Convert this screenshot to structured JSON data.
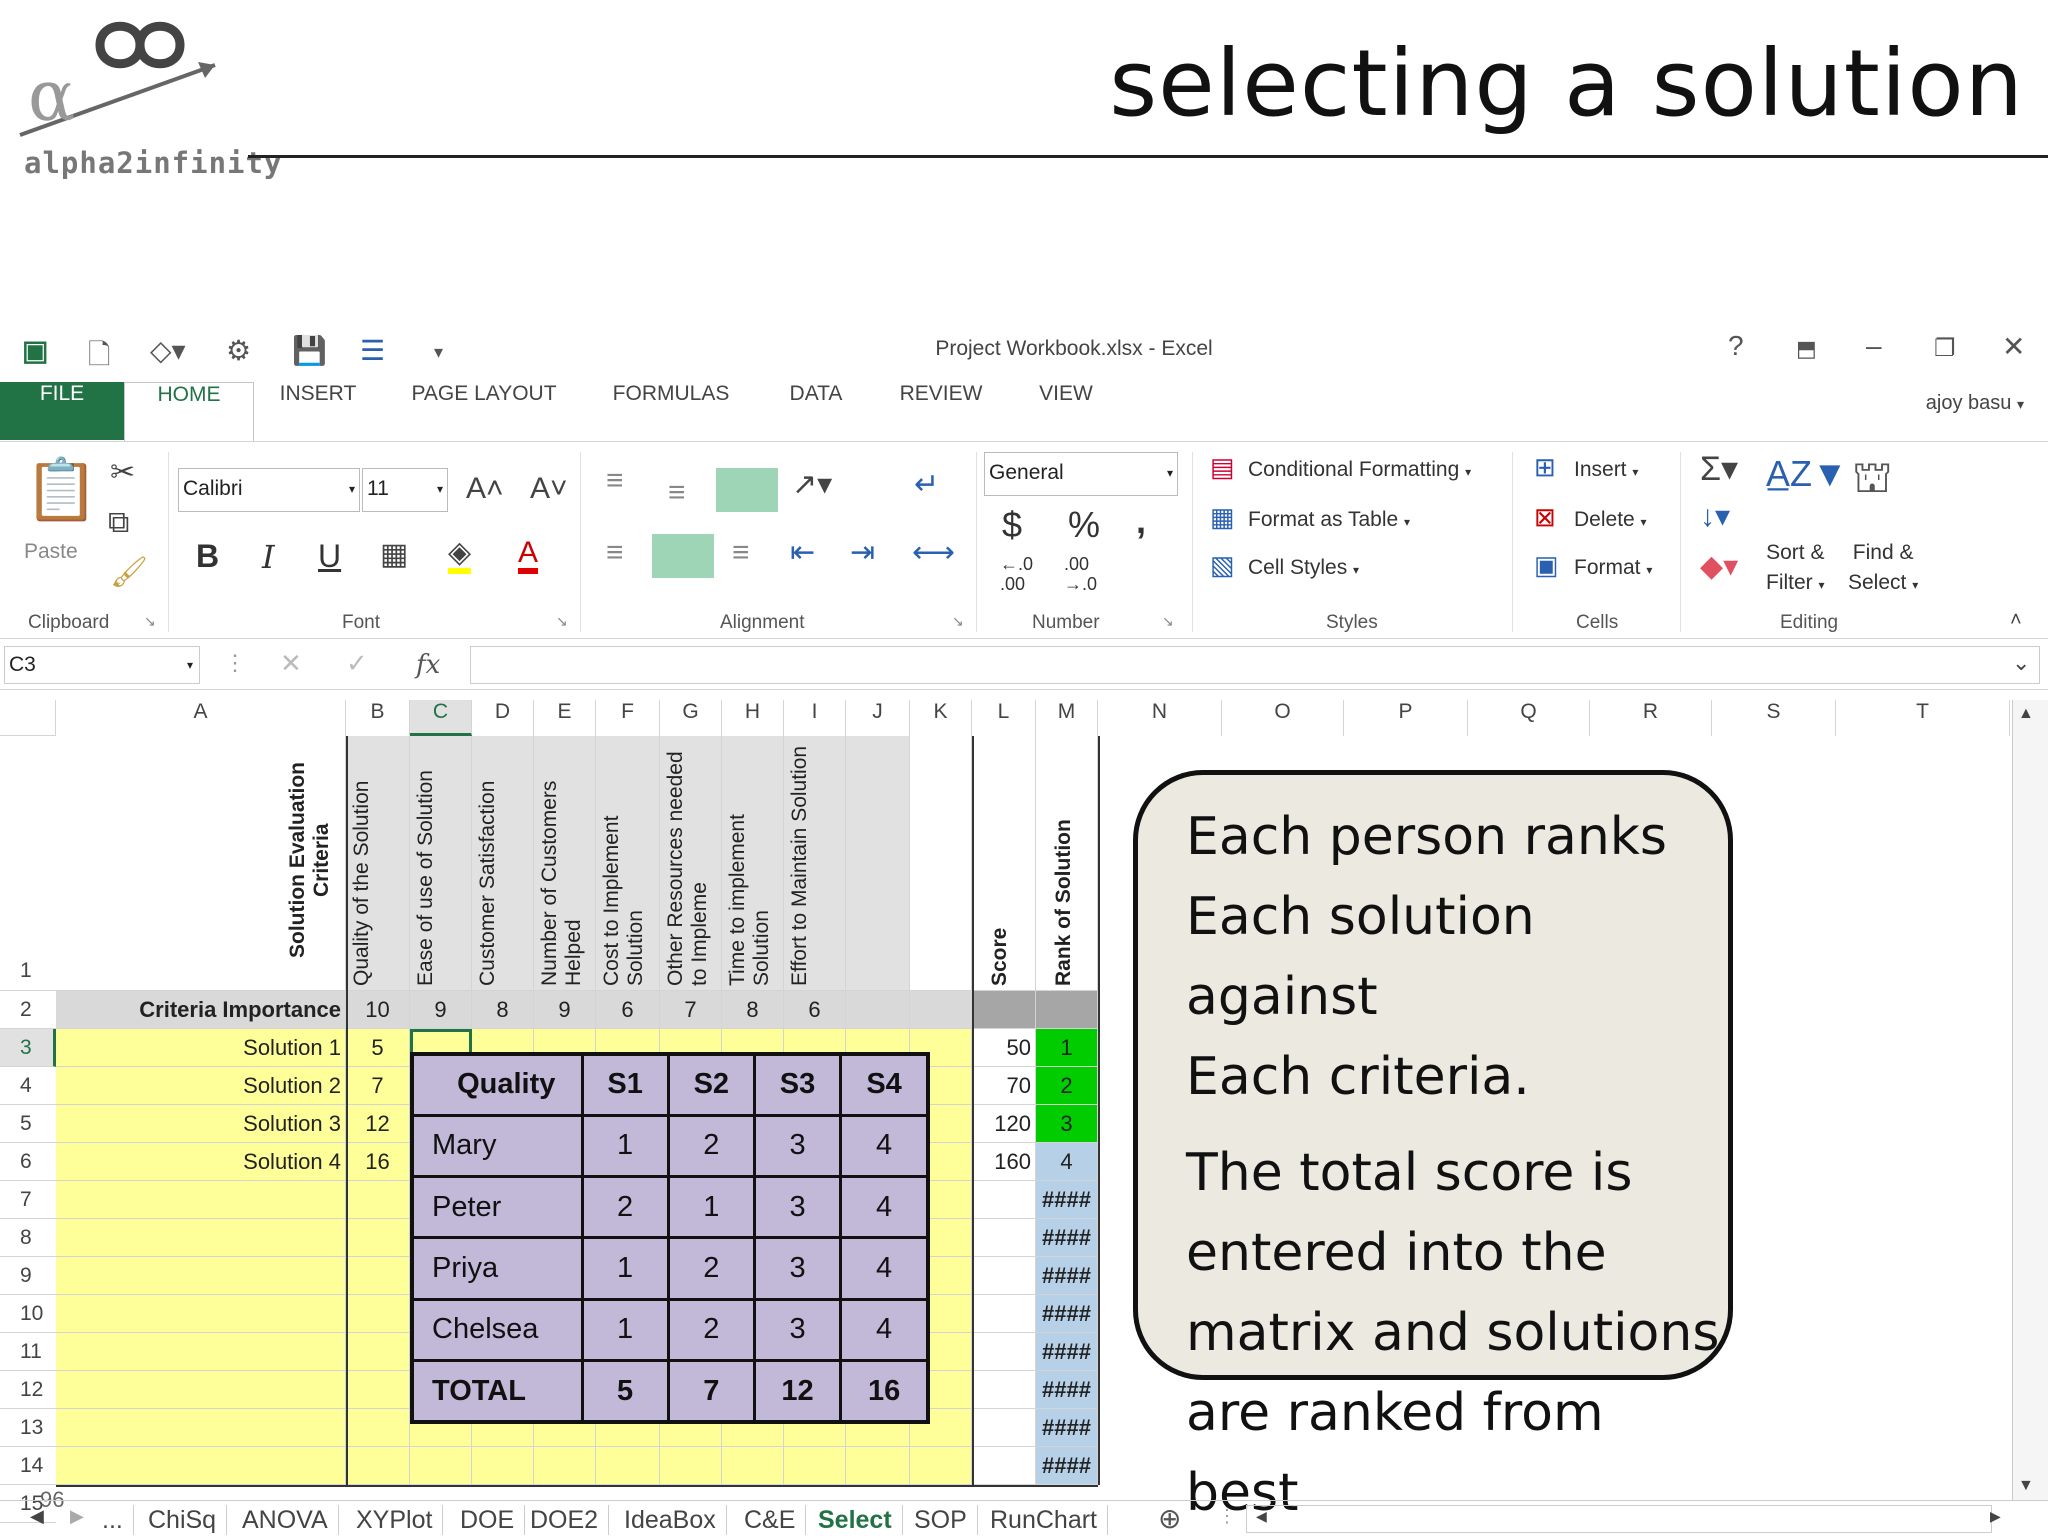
{
  "slide": {
    "title": "selecting a solution",
    "logo_text": "alpha2infinity"
  },
  "window": {
    "title": "Project Workbook.xlsx - Excel",
    "help": "?",
    "user": "ajoy basu"
  },
  "ribbon_tabs": [
    "FILE",
    "HOME",
    "INSERT",
    "PAGE LAYOUT",
    "FORMULAS",
    "DATA",
    "REVIEW",
    "VIEW"
  ],
  "ribbon": {
    "clipboard": {
      "paste": "Paste",
      "label": "Clipboard"
    },
    "font": {
      "name": "Calibri",
      "size": "11",
      "bold": "B",
      "italic": "I",
      "underline": "U",
      "label": "Font"
    },
    "alignment": {
      "label": "Alignment"
    },
    "number": {
      "format": "General",
      "currency": "$",
      "percent": "%",
      "comma": ",",
      "inc_decimal_top": "←.0",
      "inc_decimal_bottom": ".00",
      "dec_decimal_top": ".00",
      "dec_decimal_bottom": "→.0",
      "label": "Number"
    },
    "styles": {
      "conditional": "Conditional Formatting",
      "format_table": "Format as Table",
      "cell_styles": "Cell Styles",
      "label": "Styles"
    },
    "cells": {
      "insert": "Insert",
      "delete": "Delete",
      "format": "Format",
      "label": "Cells"
    },
    "editing": {
      "sort_line1": "Sort &",
      "sort_line2": "Filter",
      "find_line1": "Find &",
      "find_line2": "Select",
      "label": "Editing"
    }
  },
  "formula_bar": {
    "name_box": "C3",
    "fx": "fx",
    "value": ""
  },
  "columns": [
    "A",
    "B",
    "C",
    "D",
    "E",
    "F",
    "G",
    "H",
    "I",
    "J",
    "K",
    "L",
    "M",
    "N",
    "O",
    "P",
    "Q",
    "R",
    "S",
    "T"
  ],
  "rows": [
    "1",
    "2",
    "3",
    "4",
    "5",
    "6",
    "7",
    "8",
    "9",
    "10",
    "11",
    "12",
    "13",
    "14",
    "15"
  ],
  "sheet": {
    "a1": "Solution Evaluation Criteria",
    "criteria_headers": [
      "Quality of the Solution",
      "Ease of use of Solution",
      "Customer Satisfaction",
      "Number of Customers Helped",
      "Cost to Implement Solution",
      "Other Resources needed to Impleme",
      "Time to implement Solution",
      "Effort to Maintain Solution"
    ],
    "score_header": "Score",
    "rank_header": "Rank of Solution",
    "importance_label": "Criteria Importance",
    "importance": [
      "10",
      "9",
      "8",
      "9",
      "6",
      "7",
      "8",
      "6"
    ],
    "solutions": [
      {
        "label": "Solution 1",
        "b": "5",
        "score": "50",
        "rank": "1"
      },
      {
        "label": "Solution 2",
        "b": "7",
        "score": "70",
        "rank": "2"
      },
      {
        "label": "Solution 3",
        "b": "12",
        "score": "120",
        "rank": "3"
      },
      {
        "label": "Solution 4",
        "b": "16",
        "score": "160",
        "rank": "4"
      }
    ],
    "hash": "####",
    "row15_value": "96"
  },
  "overlay_table": {
    "headers": [
      "Quality",
      "S1",
      "S2",
      "S3",
      "S4"
    ],
    "rows": [
      [
        "Mary",
        "1",
        "2",
        "3",
        "4"
      ],
      [
        "Peter",
        "2",
        "1",
        "3",
        "4"
      ],
      [
        "Priya",
        "1",
        "2",
        "3",
        "4"
      ],
      [
        "Chelsea",
        "1",
        "2",
        "3",
        "4"
      ]
    ],
    "total": [
      "TOTAL",
      "5",
      "7",
      "12",
      "16"
    ]
  },
  "callout": {
    "lines1": [
      "Each person ranks",
      "Each solution against",
      "Each criteria."
    ],
    "lines2": [
      "The total score is",
      "entered into the",
      "matrix and solutions",
      "are ranked from best"
    ]
  },
  "sheet_tabs": [
    "...",
    "ChiSq",
    "ANOVA",
    "XYPlot",
    "DOE",
    "DOE2",
    "IdeaBox",
    "C&E",
    "Select",
    "SOP",
    "RunChart"
  ],
  "active_sheet": "Select",
  "colors": {
    "excel_green": "#217346",
    "yellow": "#ffff99",
    "rank_green": "#00cc00",
    "rank_blue": "#b6d0e8",
    "overlay": "#c2b9d9",
    "callout_bg": "#ebe9e0"
  }
}
